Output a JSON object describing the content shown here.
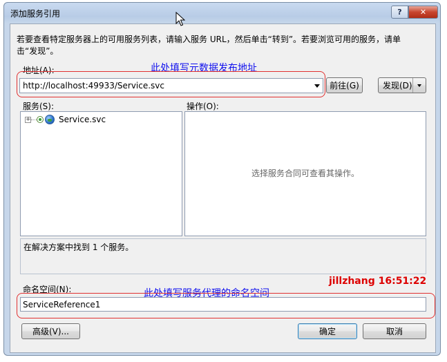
{
  "window": {
    "title": "添加服务引用",
    "help_label": "?",
    "close_label": "✕"
  },
  "instructions": "若要查看特定服务器上的可用服务列表，请输入服务 URL，然后单击“转到”。若要浏览可用的服务，请单击“发现”。",
  "address": {
    "label": "地址(A):",
    "value": "http://localhost:49933/Service.svc",
    "go_button": "前往(G)",
    "discover_button": "发现(D)"
  },
  "services": {
    "label": "服务(S):",
    "tree": [
      {
        "label": "Service.svc",
        "icon": "service-globe-icon"
      }
    ]
  },
  "operations": {
    "label": "操作(O):",
    "empty_message": "选择服务合同可查看其操作。"
  },
  "status": "在解决方案中找到 1 个服务。",
  "namespace": {
    "label": "命名空间(N):",
    "value": "ServiceReference1"
  },
  "buttons": {
    "advanced": "高级(V)...",
    "ok": "确定",
    "cancel": "取消"
  },
  "annotations": {
    "address_note": "此处填写元数据发布地址",
    "namespace_note": "此处填写服务代理的命名空间",
    "signature": "jillzhang 16:51:22"
  },
  "colors": {
    "annotation_blue": "#1010ee",
    "annotation_red": "#dd0000",
    "highlight_outline": "#e03030",
    "close_button": "#c8452f"
  }
}
